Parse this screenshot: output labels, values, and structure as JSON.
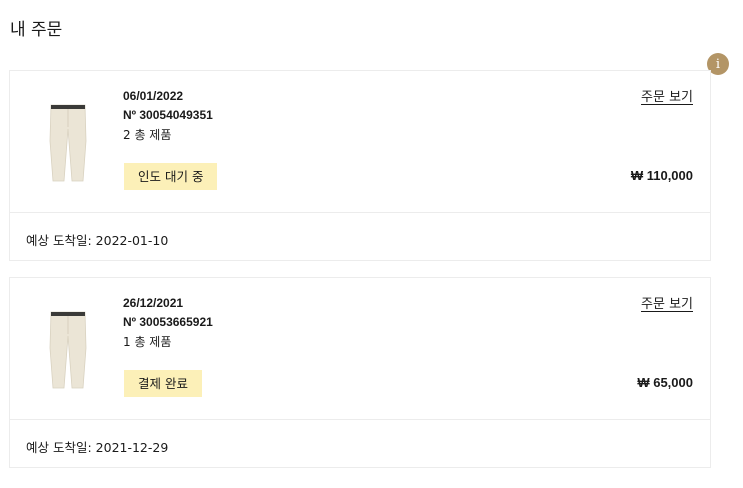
{
  "page": {
    "title": "내 주문"
  },
  "icons": {
    "info": "info-icon",
    "info_glyph": "i",
    "info_color": "#b39566"
  },
  "colors": {
    "badge_bg": "#fcf0b8",
    "border": "#ececec"
  },
  "orders": [
    {
      "date": "06/01/2022",
      "number": "Nº 30054049351",
      "item_count": "2 총 제품",
      "status": "인도 대기 중",
      "view_label": "주문 보기",
      "total": "₩ 110,000",
      "delivery": "예상 도착일: 2022-01-10",
      "thumbnail": "cream-trousers-image"
    },
    {
      "date": "26/12/2021",
      "number": "Nº 30053665921",
      "item_count": "1 총 제품",
      "status": "결제 완료",
      "view_label": "주문 보기",
      "total": "₩ 65,000",
      "delivery": "예상 도착일: 2021-12-29",
      "thumbnail": "cream-trousers-image"
    }
  ]
}
